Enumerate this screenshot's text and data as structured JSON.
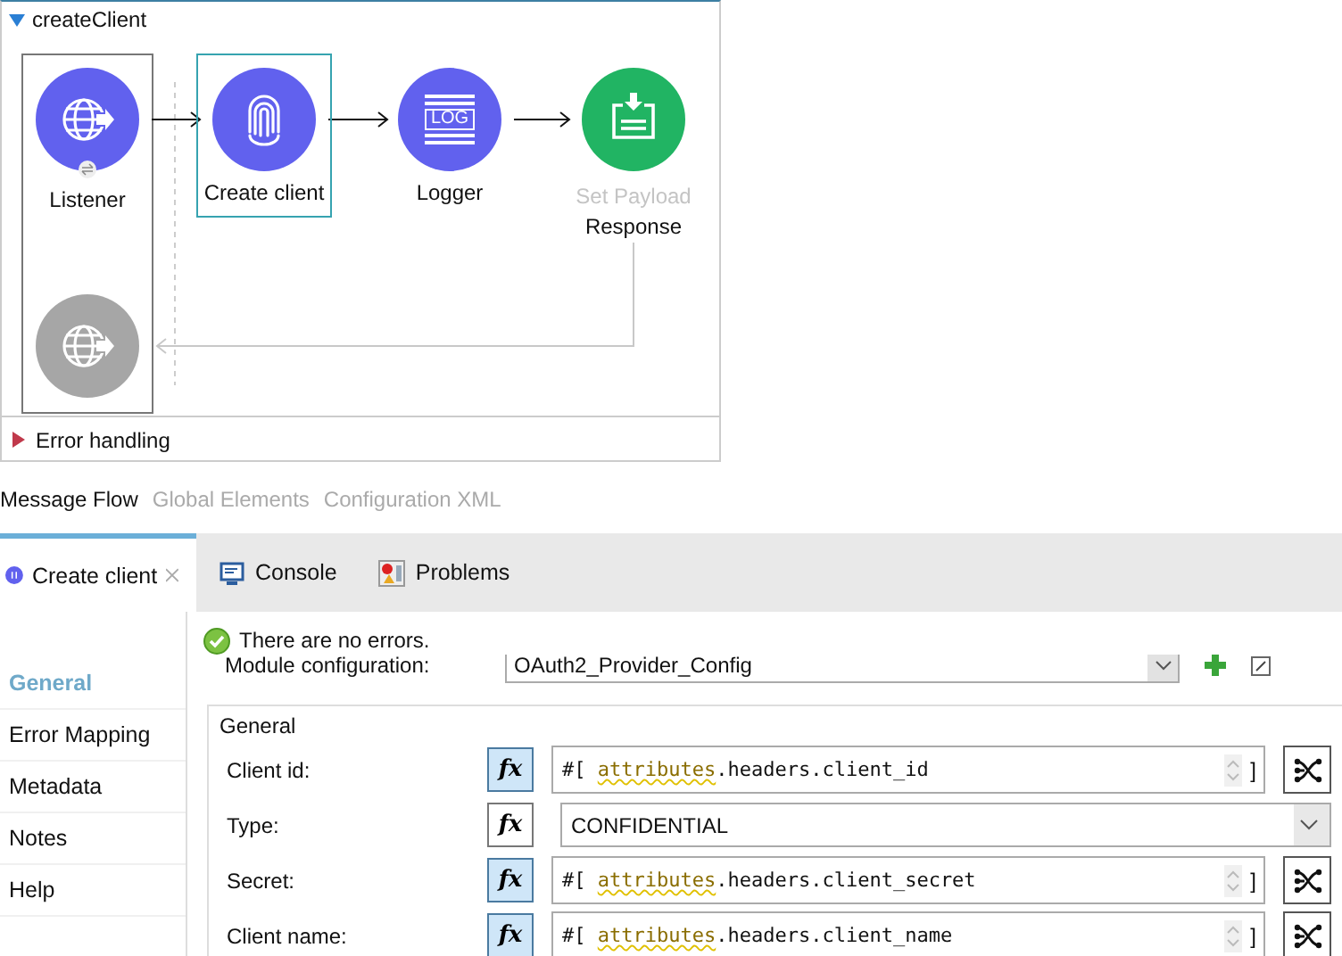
{
  "flow": {
    "title": "createClient",
    "expanded": true,
    "nodes": [
      {
        "label": "Listener",
        "kind": "listener",
        "selected": false
      },
      {
        "label": "Create client",
        "kind": "oauth",
        "selected": true
      },
      {
        "label": "Logger",
        "kind": "logger",
        "selected": false,
        "icon_text": "LOG"
      },
      {
        "label": "Response",
        "caption": "Set Payload",
        "kind": "payload",
        "selected": false
      }
    ],
    "error_handling": {
      "label": "Error handling",
      "expanded": false
    }
  },
  "editor_tabs": [
    {
      "label": "Message Flow",
      "selected": true
    },
    {
      "label": "Global Elements",
      "selected": false
    },
    {
      "label": "Configuration XML",
      "selected": false
    }
  ],
  "panel_tabs": [
    {
      "label": "Create client",
      "kind": "component",
      "selected": true,
      "closable": true
    },
    {
      "label": "Console",
      "kind": "console",
      "selected": false,
      "closable": false
    },
    {
      "label": "Problems",
      "kind": "problems",
      "selected": false,
      "closable": false
    }
  ],
  "sidebar": {
    "items": [
      {
        "label": "General",
        "selected": true
      },
      {
        "label": "Error Mapping",
        "selected": false
      },
      {
        "label": "Metadata",
        "selected": false
      },
      {
        "label": "Notes",
        "selected": false
      },
      {
        "label": "Help",
        "selected": false
      }
    ]
  },
  "status": {
    "text": "There are no errors."
  },
  "module_config": {
    "label": "Module configuration:",
    "value": "OAuth2_Provider_Config"
  },
  "general": {
    "title": "General",
    "fields": [
      {
        "label": "Client id:",
        "kind": "expression",
        "fx": "fx",
        "fx_on": true,
        "prefix": "#[",
        "expression": "attributes.headers.client_id",
        "suffix": "]"
      },
      {
        "label": "Type:",
        "kind": "select",
        "fx": "fx",
        "fx_on": false,
        "value": "CONFIDENTIAL"
      },
      {
        "label": "Secret:",
        "kind": "expression",
        "fx": "fx",
        "fx_on": true,
        "prefix": "#[",
        "expression": "attributes.headers.client_secret",
        "suffix": "]"
      },
      {
        "label": "Client name:",
        "kind": "expression",
        "fx": "fx",
        "fx_on": true,
        "prefix": "#[",
        "expression": "attributes.headers.client_name",
        "suffix": "]"
      }
    ]
  }
}
